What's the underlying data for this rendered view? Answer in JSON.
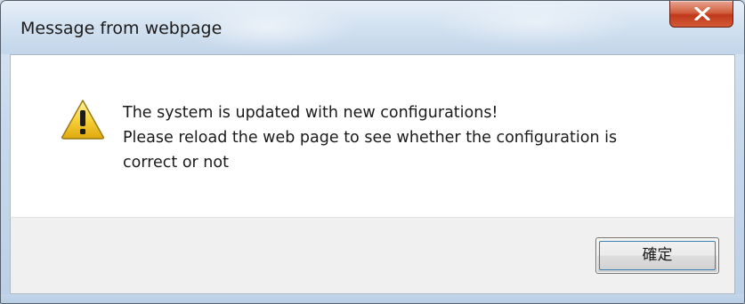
{
  "dialog": {
    "title": "Message from webpage",
    "close_icon": "close-x-icon",
    "icon": "warning-triangle-icon",
    "message_lines": [
      "The system is updated with new configurations!",
      "Please reload the web page to see whether the configuration is",
      "correct or not"
    ],
    "ok_label": "確定"
  },
  "colors": {
    "close_button": "#c7452a",
    "warning_fill": "#f5c518",
    "content_bg": "#ffffff",
    "footer_bg": "#f0f0f0"
  }
}
